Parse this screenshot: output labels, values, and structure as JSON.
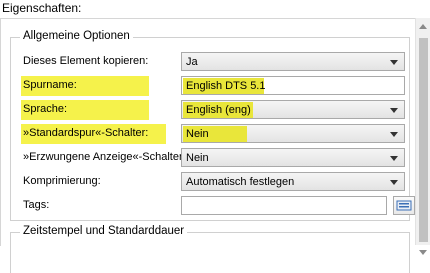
{
  "header": {
    "title": "Eigenschaften:"
  },
  "general": {
    "title": "Allgemeine Optionen",
    "rows": [
      {
        "label": "Dieses Element kopieren:",
        "value": "Ja",
        "type": "combo"
      },
      {
        "label": "Spurname:",
        "value": "English DTS 5.1",
        "type": "text",
        "highlighted": true
      },
      {
        "label": "Sprache:",
        "value": "English (eng)",
        "type": "combo",
        "highlighted": true
      },
      {
        "label": "»Standardspur«-Schalter:",
        "value": "Nein",
        "type": "combo",
        "highlighted": true
      },
      {
        "label": "»Erzwungene Anzeige«-Schalter:",
        "value": "Nein",
        "type": "combo"
      },
      {
        "label": "Komprimierung:",
        "value": "Automatisch festlegen",
        "type": "combo"
      },
      {
        "label": "Tags:",
        "value": "",
        "type": "text"
      }
    ]
  },
  "timestamps": {
    "title": "Zeitstempel und Standarddauer"
  },
  "colors": {
    "highlight": "#f5f24b",
    "border": "#a9a9a9"
  }
}
